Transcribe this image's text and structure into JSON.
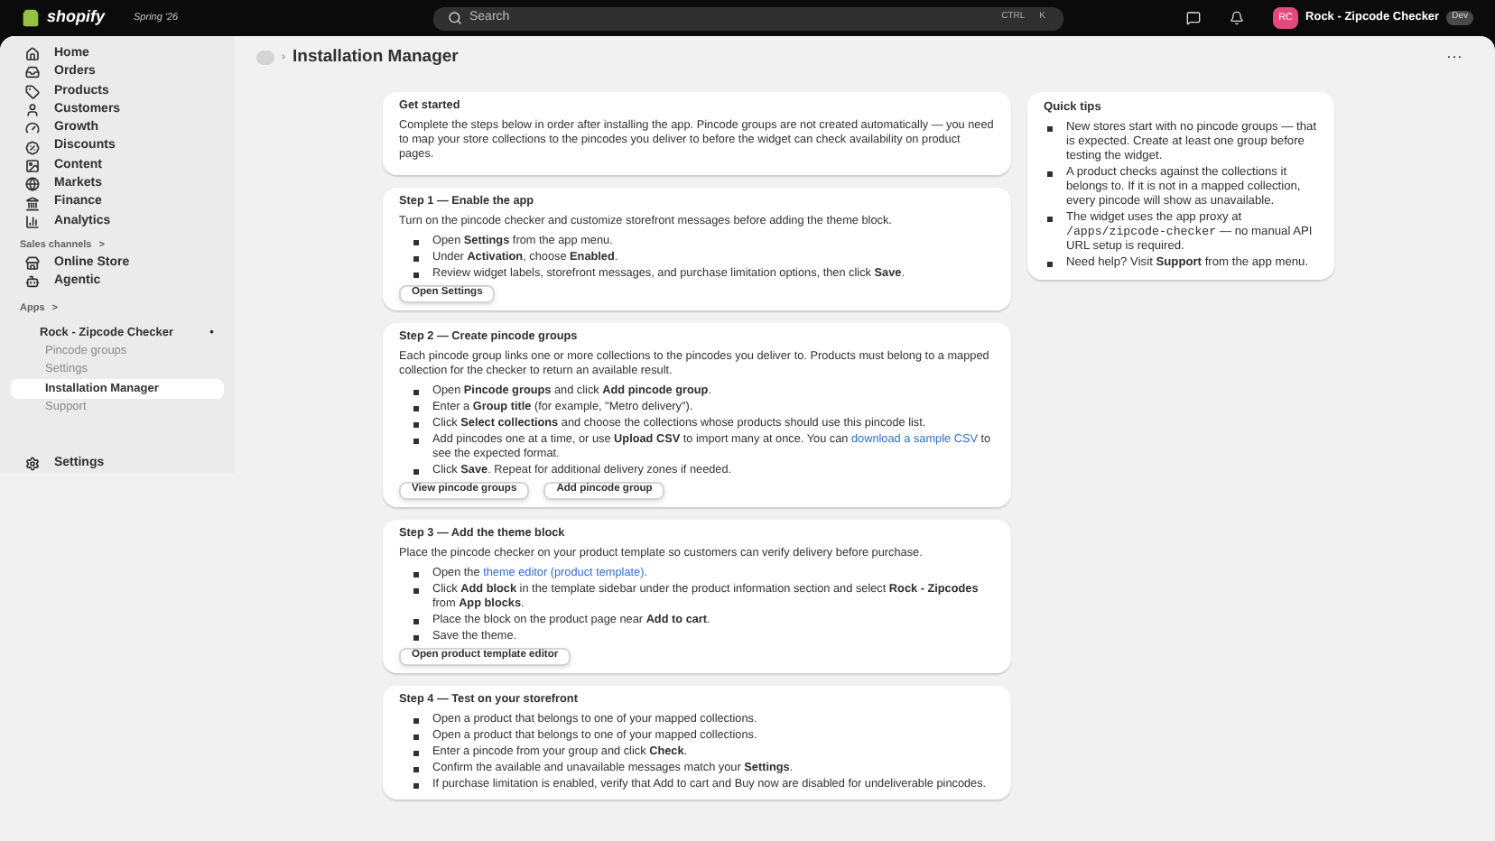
{
  "topbar": {
    "brand": "shopify",
    "edition": "Spring '26",
    "search": {
      "placeholder": "Search",
      "keys": [
        "CTRL",
        "K"
      ]
    },
    "store": {
      "initials": "RC",
      "name": "Rock - Zipcode Checker",
      "badge": "Dev"
    }
  },
  "sidebar": {
    "items": [
      {
        "label": "Home",
        "selected": false
      },
      {
        "label": "Orders",
        "selected": false
      },
      {
        "label": "Products",
        "selected": false
      },
      {
        "label": "Customers",
        "selected": false
      },
      {
        "label": "Growth",
        "selected": false
      },
      {
        "label": "Discounts",
        "selected": false
      },
      {
        "label": "Content",
        "selected": false
      },
      {
        "label": "Markets",
        "selected": false
      },
      {
        "label": "Finance",
        "selected": false
      },
      {
        "label": "Analytics",
        "selected": false
      }
    ],
    "sales_channels": {
      "heading": "Sales channels",
      "chevron": ">",
      "items": [
        {
          "label": "Online Store",
          "selected": false
        },
        {
          "label": "Agentic",
          "selected": false
        }
      ]
    },
    "apps": {
      "heading": "Apps",
      "chevron": ">",
      "app": {
        "label": "Rock - Zipcode Checker",
        "pin": "•",
        "children": [
          {
            "label": "Pincode groups",
            "selected": false
          },
          {
            "label": "Settings",
            "selected": false
          },
          {
            "label": "Installation Manager",
            "selected": true
          },
          {
            "label": "Support",
            "selected": false
          }
        ]
      }
    },
    "settings": {
      "label": "Settings"
    }
  },
  "page": {
    "separator": "›",
    "title": "Installation Manager",
    "more": "···"
  },
  "sections": [
    {
      "title": "Get started",
      "intro": "Complete the steps below in order after installing the app. Pincode groups are not created automatically — you need to map your store collections to the pincodes you deliver to before the widget can check availability on product pages."
    },
    {
      "title": "Step 1 — Enable the app",
      "intro": "Turn on the pincode checker and customize storefront messages before adding the theme block.",
      "items": [
        {
          "text": "Open **Settings** from the app menu."
        },
        {
          "text": "Under **Activation**, choose **Enabled**."
        },
        {
          "text": "Review widget labels, storefront messages, and purchase limitation options, then click **Save**."
        }
      ],
      "buttons": [
        "Open Settings"
      ]
    },
    {
      "title": "Step 2 — Create pincode groups",
      "intro": "Each pincode group links one or more collections to the pincodes you deliver to. Products must belong to a mapped collection for the checker to return an available result.",
      "items": [
        {
          "text": "Open **Pincode groups** and click **Add pincode group**."
        },
        {
          "text": "Enter a **Group title** (for example, \"Metro delivery\")."
        },
        {
          "text": "Click **Select collections** and choose the collections whose products should use this pincode list."
        },
        {
          "text": "Add pincodes one at a time, or use **Upload CSV** to import many at once. You can",
          "link": "download a sample CSV",
          "after": "to see the expected format."
        },
        {
          "text": "Click **Save**. Repeat for additional delivery zones if needed."
        }
      ],
      "buttons": [
        "View pincode groups",
        "Add pincode group"
      ]
    },
    {
      "title": "Step 3 — Add the theme block",
      "intro": "Place the pincode checker on your product template so customers can verify delivery before purchase.",
      "items": [
        {
          "text": "Open the",
          "link": "theme editor (product template)",
          "after": "."
        },
        {
          "text": "Click **Add block** in the template sidebar under the product information section and select **Rock - Zipcodes** from **App blocks**."
        },
        {
          "text": "Place the block on the product page near **Add to cart**."
        },
        {
          "text": "Save the theme."
        }
      ],
      "buttons": [
        "Open product template editor"
      ]
    },
    {
      "title": "Step 4 — Test on your storefront",
      "items": [
        {
          "text": "Open a product that belongs to one of your mapped collections."
        },
        {
          "text": "Open a product that belongs to one of your mapped collections."
        },
        {
          "text": "Enter a pincode from your group and click **Check**."
        },
        {
          "text": "Confirm the available and unavailable messages match your **Settings**."
        },
        {
          "text": "If purchase limitation is enabled, verify that Add to cart and Buy now are disabled for undeliverable pincodes."
        }
      ]
    }
  ],
  "tips": {
    "title": "Quick tips",
    "items": [
      {
        "text": "New stores start with no pincode groups — that is expected. Create at least one group before testing the widget."
      },
      {
        "text": "A product checks against the collections it belongs to. If it is not in a mapped collection, every pincode will show as unavailable."
      },
      {
        "text": "The widget uses the app proxy at",
        "code": "/apps/zipcode-checker",
        "after": "— no manual API URL setup is required."
      },
      {
        "text": "Need help? Visit **Support** from the app menu."
      }
    ]
  }
}
